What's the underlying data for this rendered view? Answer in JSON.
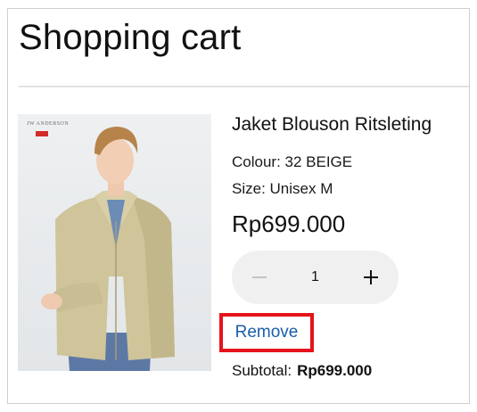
{
  "cart": {
    "title": "Shopping cart"
  },
  "item": {
    "name": "Jaket Blouson Ritsleting",
    "colour": "Colour: 32 BEIGE",
    "size": "Size: Unisex M",
    "price": "Rp699.000",
    "image_brand": "JW ANDERSON",
    "quantity": "1",
    "remove_label": "Remove",
    "subtotal_label": "Subtotal:",
    "subtotal_value": "Rp699.000"
  },
  "icons": {
    "decrement": "minus-icon",
    "increment": "plus-icon"
  },
  "colors": {
    "highlight": "#e5131b",
    "link": "#1a5ea8",
    "stepper_bg": "#f0f0f0"
  }
}
